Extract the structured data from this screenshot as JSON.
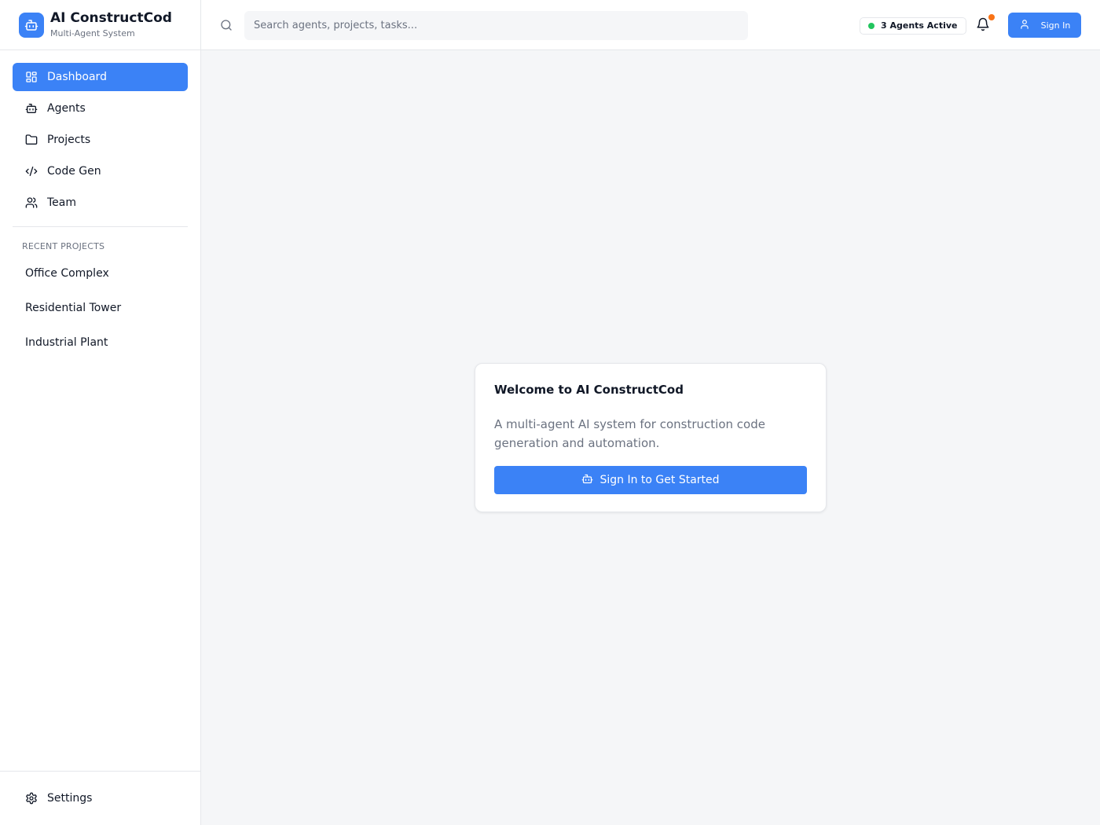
{
  "brand": {
    "title": "AI ConstructCod",
    "subtitle": "Multi-Agent System",
    "logo_icon": "robot-icon"
  },
  "sidebar": {
    "items": [
      {
        "label": "Dashboard",
        "icon": "grid-icon",
        "active": true
      },
      {
        "label": "Agents",
        "icon": "robot-icon",
        "active": false
      },
      {
        "label": "Projects",
        "icon": "folder-icon",
        "active": false
      },
      {
        "label": "Code Gen",
        "icon": "code-icon",
        "active": false
      },
      {
        "label": "Team",
        "icon": "users-icon",
        "active": false
      }
    ],
    "recent_title": "RECENT PROJECTS",
    "recent_projects": [
      "Office Complex",
      "Residential Tower",
      "Industrial Plant"
    ],
    "footer": {
      "label": "Settings",
      "icon": "gear-icon"
    }
  },
  "header": {
    "search_placeholder": "Search agents, projects, tasks...",
    "agents_status": "3 Agents Active",
    "signin_label": "Sign In"
  },
  "welcome": {
    "title": "Welcome to AI ConstructCod",
    "description": "A multi-agent AI system for construction code generation and automation.",
    "cta_label": "Sign In to Get Started"
  },
  "colors": {
    "accent": "#3b82f6",
    "status_active": "#22c55e",
    "notification": "#f97316",
    "background": "#f5f6f8"
  }
}
